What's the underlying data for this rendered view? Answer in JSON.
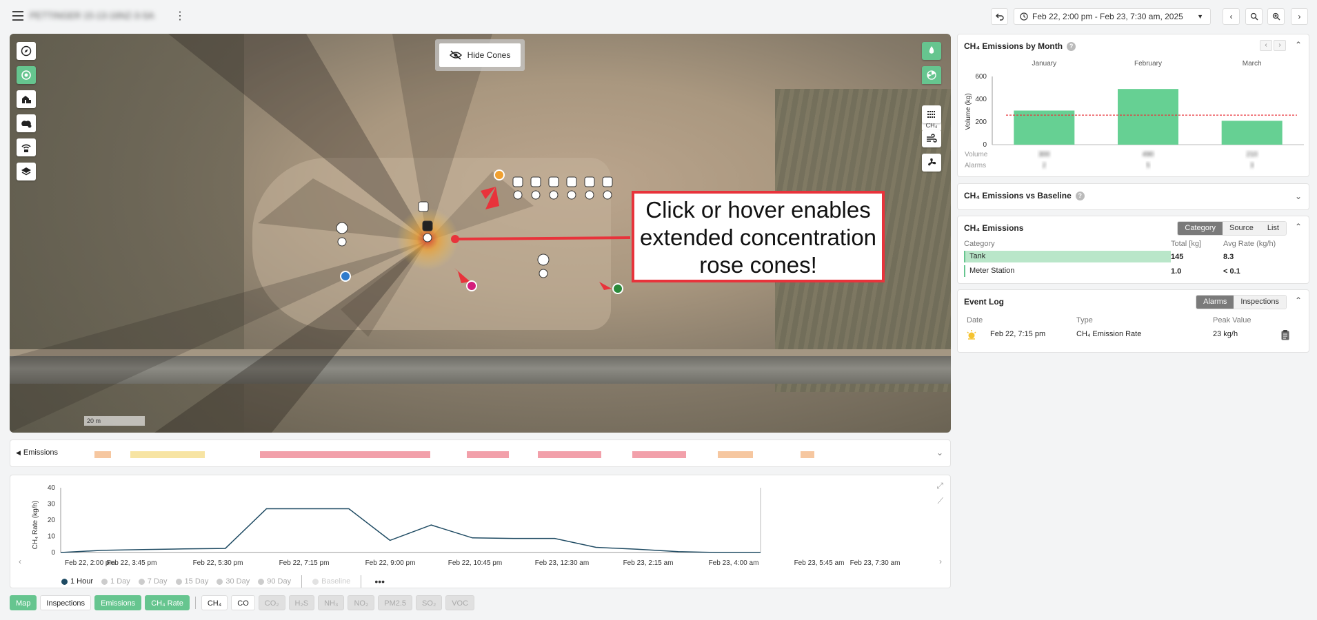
{
  "topbar": {
    "site_name": "PETTINGER 15-13-16NZ-3-SA",
    "date_range": "Feb 22, 2:00 pm - Feb 23, 7:30 am, 2025"
  },
  "map": {
    "hide_cones_label": "Hide Cones",
    "ch4_label": "CH₄",
    "scale_label": "20 m",
    "callout": [
      "Click or hover enables",
      "extended concentration",
      "rose cones!"
    ]
  },
  "timeline": {
    "label": "Emissions",
    "segments": [
      {
        "start": 0.035,
        "end": 0.054,
        "color": "#f6c7a0"
      },
      {
        "start": 0.076,
        "end": 0.162,
        "color": "#f7e4a3"
      },
      {
        "start": 0.225,
        "end": 0.421,
        "color": "#f2a0aa"
      },
      {
        "start": 0.463,
        "end": 0.511,
        "color": "#f2a0aa"
      },
      {
        "start": 0.544,
        "end": 0.617,
        "color": "#f2a0aa"
      },
      {
        "start": 0.653,
        "end": 0.715,
        "color": "#f2a0aa"
      },
      {
        "start": 0.751,
        "end": 0.792,
        "color": "#f6c7a0"
      },
      {
        "start": 0.846,
        "end": 0.862,
        "color": "#f6c7a0"
      }
    ]
  },
  "rate_chart": {
    "ylabel": "CH₄ Rate (kg/h)",
    "yticks": [
      0,
      10,
      20,
      30,
      40
    ],
    "xticks": [
      "Feb 22, 2:00 pm",
      "Feb 22, 3:45 pm",
      "Feb 22, 5:30 pm",
      "Feb 22, 7:15 pm",
      "Feb 22, 9:00 pm",
      "Feb 22, 10:45 pm",
      "Feb 23, 12:30 am",
      "Feb 23, 2:15 am",
      "Feb 23, 4:00 am",
      "Feb 23, 5:45 am",
      "Feb 23, 7:30 am"
    ],
    "periods": [
      "1 Hour",
      "1 Day",
      "7 Day",
      "15 Day",
      "30 Day",
      "90 Day"
    ],
    "baseline_label": "Baseline",
    "more_label": "•••"
  },
  "chart_data": [
    {
      "type": "line",
      "ylabel": "CH₄ Rate (kg/h)",
      "ylim": [
        0,
        40
      ],
      "x": [
        "Feb 22, 2:00 pm",
        "Feb 22, 3:00 pm",
        "Feb 22, 4:00 pm",
        "Feb 22, 5:00 pm",
        "Feb 22, 6:00 pm",
        "Feb 22, 7:00 pm",
        "Feb 22, 8:00 pm",
        "Feb 22, 9:00 pm",
        "Feb 22, 10:00 pm",
        "Feb 22, 11:00 pm",
        "Feb 23, 12:00 am",
        "Feb 23, 1:00 am",
        "Feb 23, 2:00 am",
        "Feb 23, 3:00 am",
        "Feb 23, 4:00 am",
        "Feb 23, 5:00 am",
        "Feb 23, 6:00 am",
        "Feb 23, 7:30 am"
      ],
      "series": [
        {
          "values": [
            0,
            1.3,
            1.8,
            2.2,
            2.5,
            27,
            27,
            27,
            7.5,
            17,
            9,
            8.7,
            8.7,
            3.2,
            2,
            0.5,
            0,
            0
          ]
        }
      ]
    },
    {
      "type": "bar",
      "title": "CH₄ Emissions by Month",
      "ylabel": "Volume (kg)",
      "categories": [
        "January",
        "February",
        "March"
      ],
      "values": [
        300,
        490,
        210
      ],
      "ylim": [
        0,
        600
      ],
      "yticks": [
        0,
        200,
        400,
        600
      ],
      "baseline": 260
    }
  ],
  "month_panel": {
    "title": "CH₄ Emissions by Month",
    "row_volume": "Volume",
    "row_alarms": "Alarms",
    "volume_values": [
      "300",
      "490",
      "210"
    ],
    "alarm_values": [
      "2",
      "5",
      "3"
    ]
  },
  "baseline_panel": {
    "title": "CH₄ Emissions vs Baseline"
  },
  "emissions_panel": {
    "title": "CH₄ Emissions",
    "tabs": [
      "Category",
      "Source",
      "List"
    ],
    "headers": [
      "Category",
      "Total [kg]",
      "Avg Rate (kg/h)"
    ],
    "rows": [
      {
        "category": "Tank",
        "total": "145",
        "rate": "8.3",
        "share": 1.0
      },
      {
        "category": "Meter Station",
        "total": "1.0",
        "rate": "< 0.1",
        "share": 0.01
      }
    ]
  },
  "event_log": {
    "title": "Event Log",
    "tabs": [
      "Alarms",
      "Inspections"
    ],
    "headers": [
      "Date",
      "Type",
      "Peak Value"
    ],
    "rows": [
      {
        "date": "Feb 22, 7:15 pm",
        "type": "CH₄ Emission Rate",
        "peak": "23 kg/h"
      }
    ]
  },
  "bottom_tabs": {
    "views": [
      {
        "label": "Map",
        "style": "green"
      },
      {
        "label": "Inspections",
        "style": "plain"
      },
      {
        "label": "Emissions",
        "style": "green"
      },
      {
        "label": "CH₄ Rate",
        "style": "green"
      }
    ],
    "gases": [
      {
        "label": "CH₄",
        "style": "plain"
      },
      {
        "label": "CO",
        "style": "plain"
      },
      {
        "label": "CO₂",
        "style": "disabled"
      },
      {
        "label": "H₂S",
        "style": "disabled"
      },
      {
        "label": "NH₃",
        "style": "disabled"
      },
      {
        "label": "NO₂",
        "style": "disabled"
      },
      {
        "label": "PM2.5",
        "style": "disabled"
      },
      {
        "label": "SO₂",
        "style": "disabled"
      },
      {
        "label": "VOC",
        "style": "disabled"
      }
    ]
  }
}
